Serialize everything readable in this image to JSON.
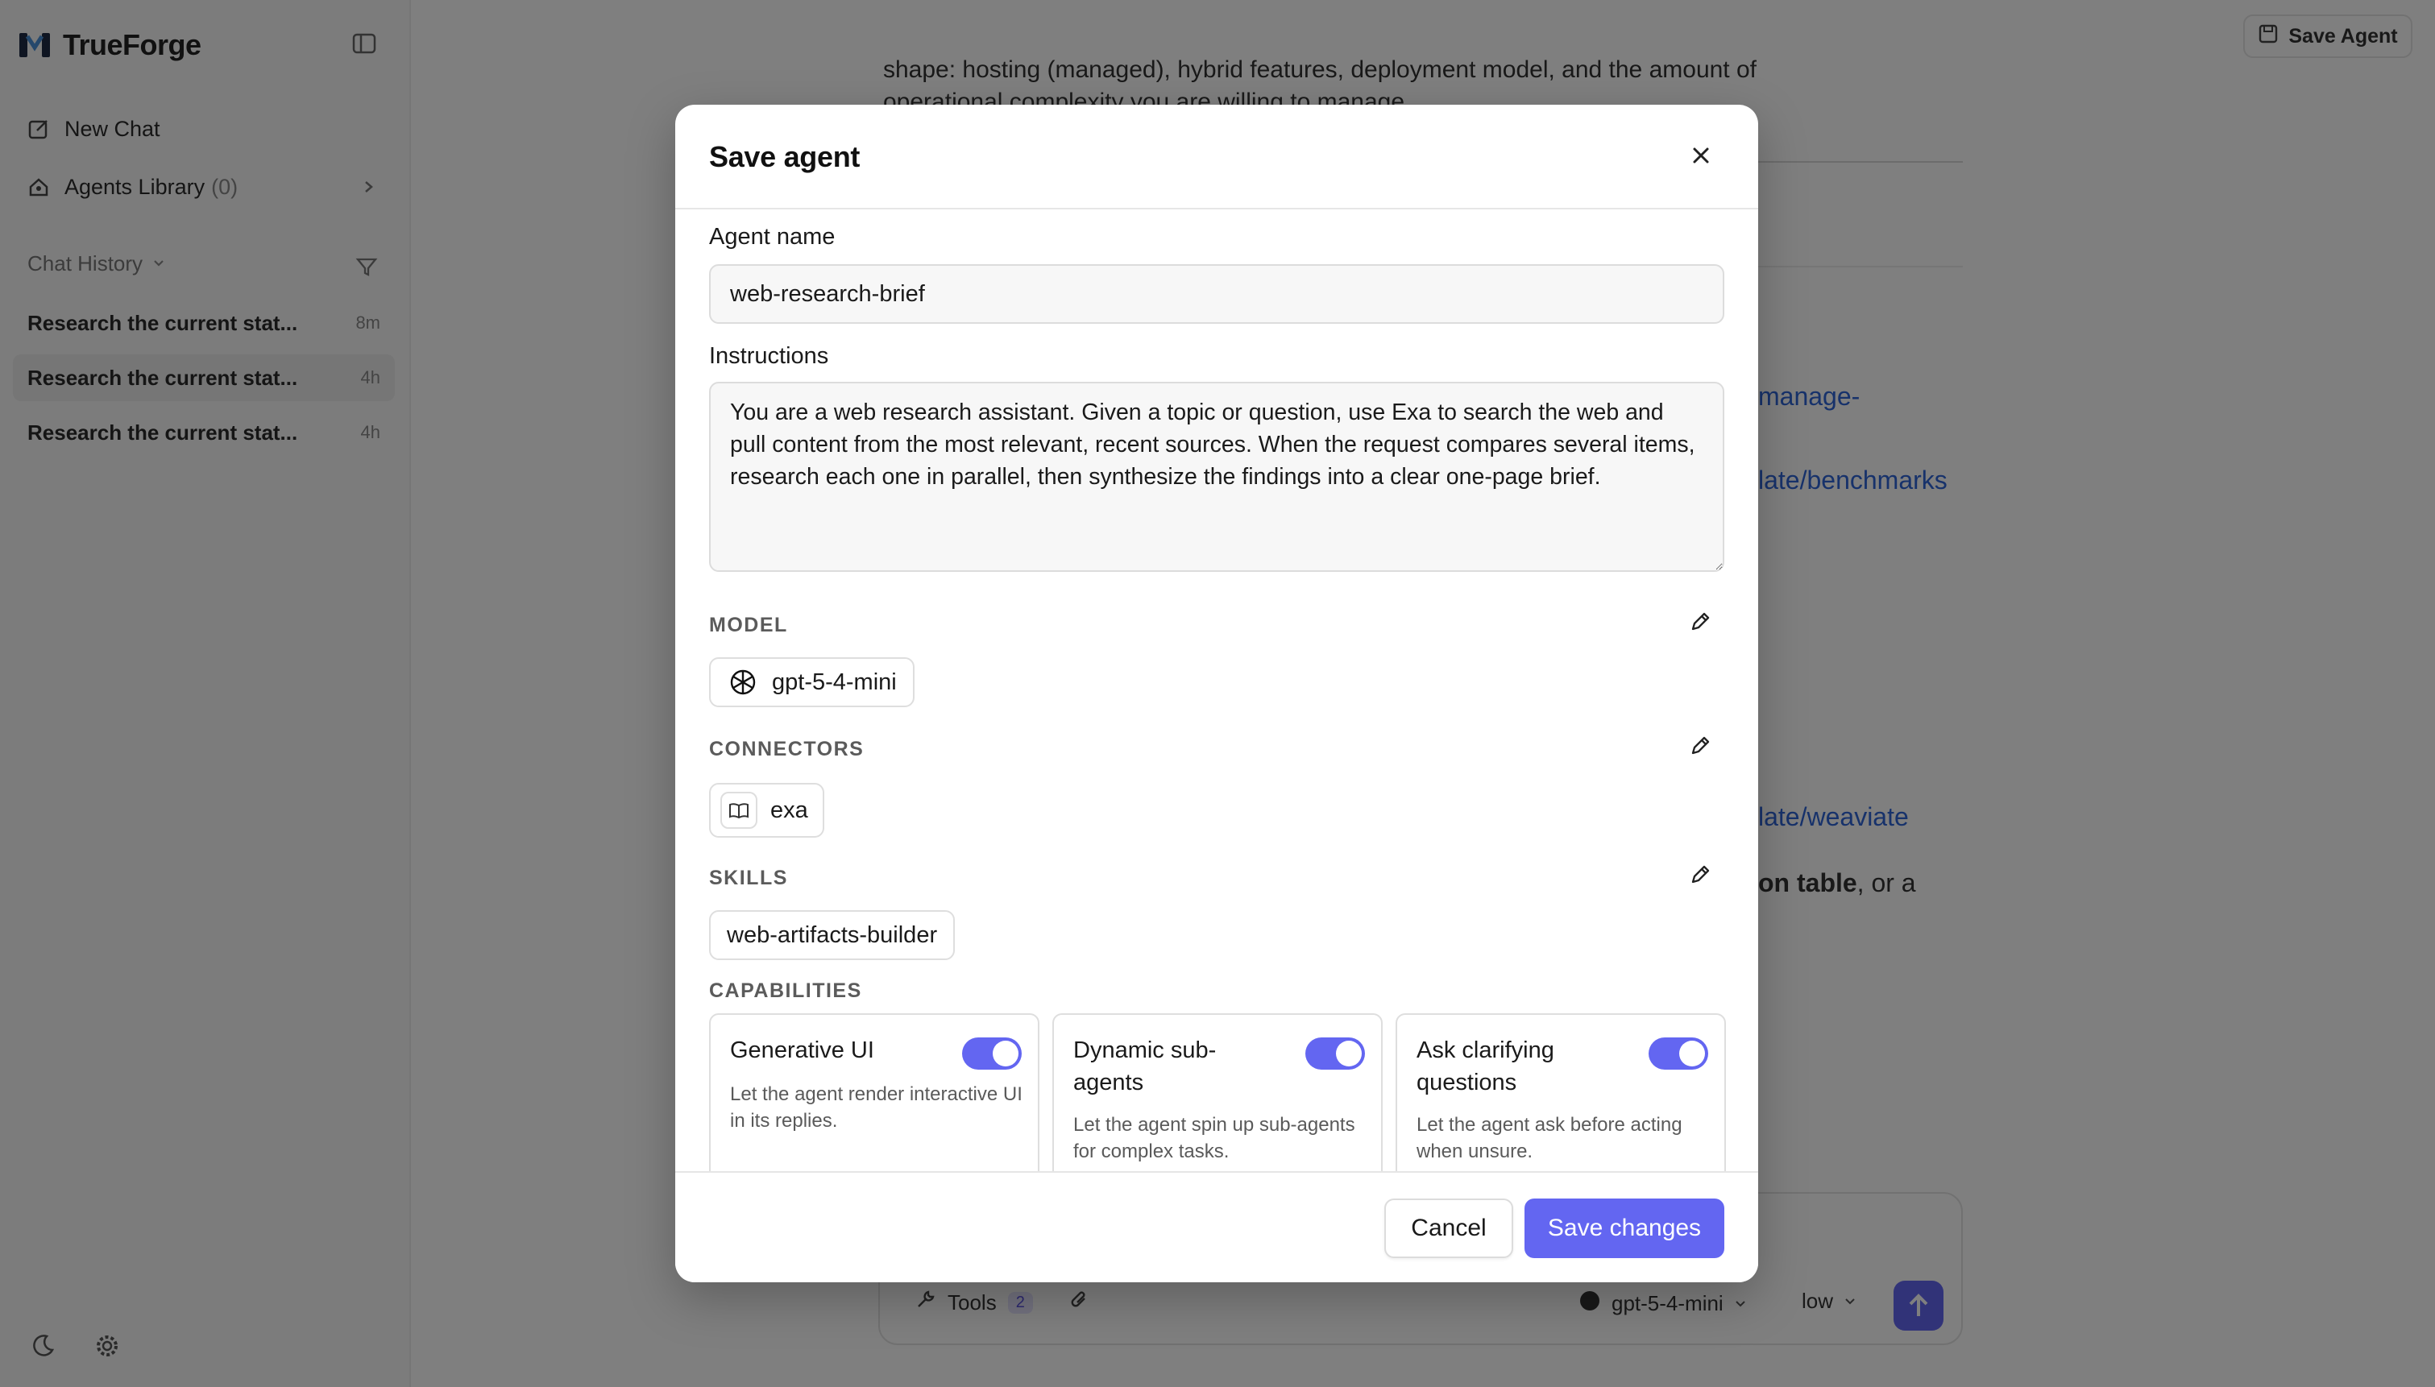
{
  "app": {
    "name": "TrueForge"
  },
  "sidebar": {
    "new_chat": "New Chat",
    "agents_library": "Agents Library",
    "agents_count": "(0)",
    "chat_history": "Chat History",
    "history": [
      {
        "title": "Research the current stat...",
        "time": "8m"
      },
      {
        "title": "Research the current stat...",
        "time": "4h"
      },
      {
        "title": "Research the current stat...",
        "time": "4h"
      }
    ]
  },
  "header": {
    "save_agent": "Save Agent"
  },
  "background": {
    "line1": "shape: hosting (managed), hybrid features, deployment model, and the amount of",
    "line2": "operational complexity you are willing to manage.",
    "link1": "manage-",
    "link2": "late/benchmarks",
    "link3": "late/weaviate",
    "text_bold": "on table",
    "text_tail": ", or a"
  },
  "composer": {
    "tools": "Tools",
    "tools_count": "2",
    "model": "gpt-5-4-mini",
    "effort": "low"
  },
  "modal": {
    "title": "Save agent",
    "agent_name_label": "Agent name",
    "agent_name_value": "web-research-brief",
    "instructions_label": "Instructions",
    "instructions_value": "You are a web research assistant. Given a topic or question, use Exa to search the web and pull content from the most relevant, recent sources. When the request compares several items, research each one in parallel, then synthesize the findings into a clear one-page brief.",
    "model_label": "MODEL",
    "model_value": "gpt-5-4-mini",
    "connectors_label": "CONNECTORS",
    "connector_value": "exa",
    "skills_label": "SKILLS",
    "skill_value": "web-artifacts-builder",
    "capabilities_label": "CAPABILITIES",
    "capabilities": [
      {
        "title": "Generative UI",
        "desc": "Let the agent render interactive UI in its replies.",
        "enabled": true
      },
      {
        "title": "Dynamic sub-agents",
        "desc": "Let the agent spin up sub-agents for complex tasks.",
        "enabled": true
      },
      {
        "title": "Ask clarifying questions",
        "desc": "Let the agent ask before acting when unsure.",
        "enabled": true
      }
    ],
    "cancel": "Cancel",
    "save": "Save changes"
  },
  "colors": {
    "accent": "#6366f1",
    "link": "#2f64d6",
    "overlay": "rgba(0,0,0,0.5)"
  }
}
